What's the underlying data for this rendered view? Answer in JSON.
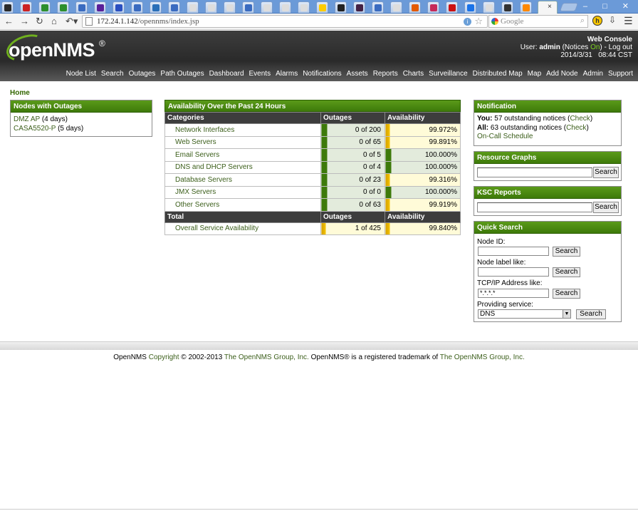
{
  "browser": {
    "active_tab_close": "×",
    "url_host": "172.24.1.142",
    "url_path": "/opennms/index.jsp",
    "search_placeholder": "Google",
    "window_controls": "– □ ✕",
    "tab_favicon_colors": [
      "#2a2a2a",
      "#cc2222",
      "#2d8f2d",
      "#2d8f2d",
      "#3a6bc0",
      "#5a1f99",
      "#2a4fc0",
      "#3a6bc0",
      "#2a6fb8",
      "#3a6bc0",
      "#dddddd",
      "#dddddd",
      "#dddddd",
      "#3a6bc0",
      "#dddddd",
      "#dddddd",
      "#dddddd",
      "#ffcc00",
      "#222222",
      "#442244",
      "#3a6bc0",
      "#dddddd",
      "#e35a00",
      "#c62a5a",
      "#cc1111",
      "#1a73e8",
      "#dddddd",
      "#333333",
      "#ff8800"
    ]
  },
  "header": {
    "logo": "openNMS",
    "logo_reg": "®",
    "console_title": "Web Console",
    "user_prefix": "User: ",
    "user": "admin",
    "notices_prefix": " (Notices ",
    "notices_state": "On",
    "notices_suffix": ") - ",
    "logout": "Log out",
    "date": "2014/3/31",
    "time": "08:44 CST",
    "nav": [
      "Node List",
      "Search",
      "Outages",
      "Path Outages",
      "Dashboard",
      "Events",
      "Alarms",
      "Notifications",
      "Assets",
      "Reports",
      "Charts",
      "Surveillance",
      "Distributed Map",
      "Map",
      "Add Node",
      "Admin",
      "Support"
    ]
  },
  "breadcrumb": "Home",
  "nodes_outages": {
    "title": "Nodes with Outages",
    "items": [
      {
        "name": "DMZ AP",
        "duration": " (4 days)"
      },
      {
        "name": "CASA5520-P",
        "duration": " (5 days)"
      }
    ]
  },
  "availability": {
    "title": "Availability Over the Past 24 Hours",
    "headers": [
      "Categories",
      "Outages",
      "Availability"
    ],
    "rows": [
      {
        "category": "Network Interfaces",
        "outages": "0 of 200",
        "availability": "99.972%"
      },
      {
        "category": "Web Servers",
        "outages": "0 of 65",
        "availability": "99.891%"
      },
      {
        "category": "Email Servers",
        "outages": "0 of 5",
        "availability": "100.000%"
      },
      {
        "category": "DNS and DHCP Servers",
        "outages": "0 of 4",
        "availability": "100.000%"
      },
      {
        "category": "Database Servers",
        "outages": "0 of 23",
        "availability": "99.316%"
      },
      {
        "category": "JMX Servers",
        "outages": "0 of 0",
        "availability": "100.000%"
      },
      {
        "category": "Other Servers",
        "outages": "0 of 63",
        "availability": "99.919%"
      }
    ],
    "total_headers": [
      "Total",
      "Outages",
      "Availability"
    ],
    "total_row": {
      "category": "Overall Service Availability",
      "outages": "1 of 425",
      "availability": "99.840%"
    }
  },
  "notification": {
    "title": "Notification",
    "you_label": "You:",
    "you_text": " 57 outstanding notices (",
    "all_label": "All:",
    "all_text": " 63 outstanding notices (",
    "check": "Check",
    "close_paren": ")",
    "oncall": "On-Call Schedule"
  },
  "resource_graphs": {
    "title": "Resource Graphs",
    "button": "Search"
  },
  "ksc_reports": {
    "title": "KSC Reports",
    "button": "Search"
  },
  "quick_search": {
    "title": "Quick Search",
    "node_id_label": "Node ID:",
    "node_label_label": "Node label like:",
    "ip_label": "TCP/IP Address like:",
    "ip_value": "*.*.*.*",
    "service_label": "Providing service:",
    "service_value": "DNS",
    "button": "Search"
  },
  "footer": {
    "p1": "OpenNMS ",
    "copyright": "Copyright",
    "p2": " © 2002-2013 ",
    "group1": "The OpenNMS Group, Inc.",
    "p3": " OpenNMS® is a registered trademark of ",
    "group2": "The OpenNMS Group, Inc."
  },
  "colors": {
    "accent_green": "#3e7a0a",
    "header_dark": "#2a2a2a",
    "avail_yellow": "#f5c400"
  }
}
